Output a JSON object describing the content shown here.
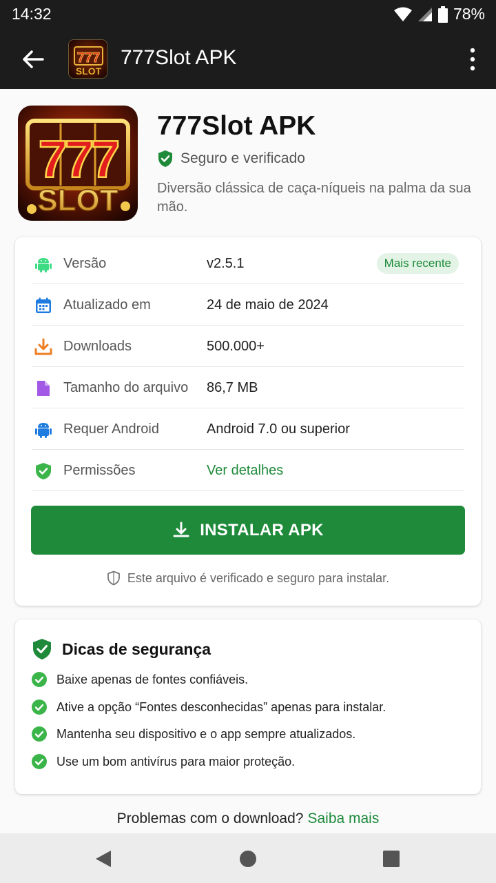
{
  "status_bar": {
    "time": "14:32",
    "battery": "78%"
  },
  "app_bar": {
    "title": "777Slot APK",
    "logo_text_top": "777",
    "logo_text_bottom": "SLOT"
  },
  "header": {
    "app_name": "777Slot APK",
    "verified_label": "Seguro e verificado",
    "description": "Diversão clássica de caça-níqueis na palma da sua mão.",
    "icon_text_top": "777",
    "icon_text_bottom": "SLOT"
  },
  "info": {
    "rows": [
      {
        "icon": "android-icon",
        "label": "Versão",
        "value": "v2.5.1",
        "badge": "Mais recente"
      },
      {
        "icon": "calendar-icon",
        "label": "Atualizado em",
        "value": "24 de maio de 2024"
      },
      {
        "icon": "download-icon",
        "label": "Downloads",
        "value": "500.000+"
      },
      {
        "icon": "file-icon",
        "label": "Tamanho do arquivo",
        "value": "86,7 MB"
      },
      {
        "icon": "android-robot-icon",
        "label": "Requer Android",
        "value": "Android 7.0 ou superior"
      },
      {
        "icon": "shield-check-icon",
        "label": "Permissões",
        "value": "Ver detalhes"
      }
    ],
    "install_label": "INSTALAR APK",
    "safe_note": "Este arquivo é verificado e seguro para instalar."
  },
  "tips": {
    "title": "Dicas de segurança",
    "items": [
      "Baixe apenas de fontes confiáveis.",
      "Ative a opção “Fontes desconhecidas” apenas para instalar.",
      "Mantenha seu dispositivo e o app sempre atualizados.",
      "Use um bom antivírus para maior proteção."
    ]
  },
  "help": {
    "text": "Problemas com o download?",
    "link": "Saiba mais"
  },
  "colors": {
    "accent": "#1e8a3a",
    "bar": "#1c1c1c",
    "android_green": "#3ddc84"
  }
}
